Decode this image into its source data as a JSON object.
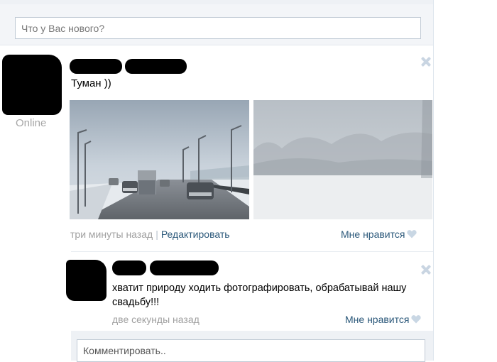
{
  "status": {
    "placeholder": "Что у Вас нового?"
  },
  "post": {
    "online_label": "Online",
    "text": "Туман ))",
    "time": "три минуты назад",
    "separator": "|",
    "edit_label": "Редактировать",
    "like_label": "Мне нравится"
  },
  "comment": {
    "text": "хватит природу ходить фотографировать, обрабатывай нашу свадьбу!!!",
    "time": "две секунды назад",
    "like_label": "Мне нравится"
  },
  "reply": {
    "placeholder": "Комментировать.."
  },
  "icons": {
    "close": "close-icon",
    "like": "heart-icon"
  }
}
